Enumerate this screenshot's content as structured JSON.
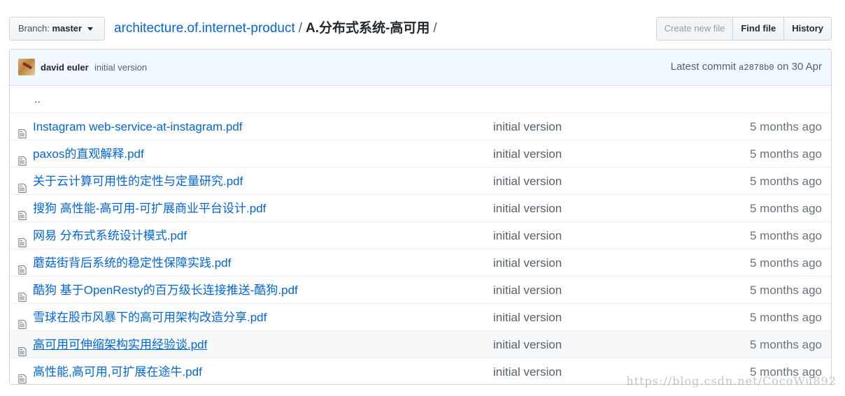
{
  "branch": {
    "label": "Branch:",
    "value": "master"
  },
  "breadcrumb": {
    "repo": "architecture.of.internet-product",
    "separator": "/",
    "folder": "A.分布式系统-高可用",
    "trailing": "/"
  },
  "toolbar": {
    "create_label": "Create new file",
    "find_label": "Find file",
    "history_label": "History"
  },
  "commit": {
    "author": "david euler",
    "message": "initial version",
    "latest_prefix": "Latest commit",
    "sha": "a2878b0",
    "on": "on",
    "date": "30 Apr"
  },
  "updir": "..",
  "files": [
    {
      "name": "Instagram web-service-at-instagram.pdf",
      "message": "initial version",
      "age": "5 months ago"
    },
    {
      "name": "paxos的直观解释.pdf",
      "message": "initial version",
      "age": "5 months ago"
    },
    {
      "name": "关于云计算可用性的定性与定量研究.pdf",
      "message": "initial version",
      "age": "5 months ago"
    },
    {
      "name": "搜狗 高性能-高可用-可扩展商业平台设计.pdf",
      "message": "initial version",
      "age": "5 months ago"
    },
    {
      "name": "网易 分布式系统设计模式.pdf",
      "message": "initial version",
      "age": "5 months ago"
    },
    {
      "name": "蘑菇街背后系统的稳定性保障实践.pdf",
      "message": "initial version",
      "age": "5 months ago"
    },
    {
      "name": "酷狗 基于OpenResty的百万级长连接推送-酷狗.pdf",
      "message": "initial version",
      "age": "5 months ago"
    },
    {
      "name": "雪球在股市风暴下的高可用架构改造分享.pdf",
      "message": "initial version",
      "age": "5 months ago"
    },
    {
      "name": "高可用可伸缩架构实用经验谈.pdf",
      "message": "initial version",
      "age": "5 months ago"
    },
    {
      "name": "高性能,高可用,可扩展在途牛.pdf",
      "message": "initial version",
      "age": "5 months ago"
    }
  ],
  "icons": {
    "file": "file-text-icon",
    "caret": "caret-down-icon",
    "avatar": "user-avatar"
  },
  "colors": {
    "link": "#0366d6",
    "commit_bar": "#f1f8ff",
    "muted": "#586069"
  },
  "watermark": "https://blog.csdn.net/CocoWu892"
}
